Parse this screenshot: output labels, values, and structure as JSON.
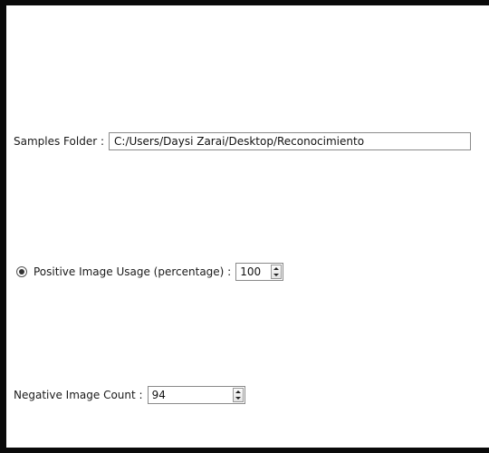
{
  "samples": {
    "label": "Samples Folder :",
    "value": "C:/Users/Daysi Zarai/Desktop/Reconocimiento"
  },
  "positive": {
    "label": "Positive Image Usage (percentage) :",
    "value": "100",
    "radio_selected": true
  },
  "negative": {
    "label": "Negative Image Count :",
    "value": "94"
  },
  "colors": {
    "border": "#0a0a0a",
    "background": "#ffffff",
    "text": "#1a1a1a"
  },
  "icons": {
    "spin_up": "triangle-up-icon",
    "spin_down": "triangle-down-icon",
    "radio": "radio-selected-icon"
  }
}
